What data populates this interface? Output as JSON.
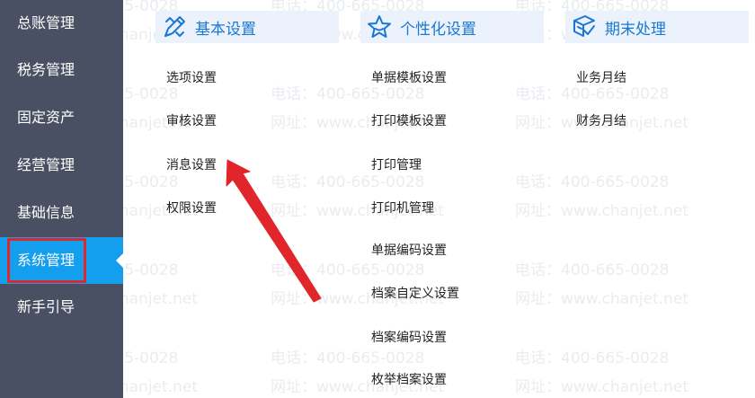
{
  "sidebar": {
    "items": [
      {
        "label": "总账管理"
      },
      {
        "label": "税务管理"
      },
      {
        "label": "固定资产"
      },
      {
        "label": "经营管理"
      },
      {
        "label": "基础信息"
      },
      {
        "label": "系统管理",
        "active": true
      },
      {
        "label": "新手引导"
      }
    ]
  },
  "watermark": {
    "phone": "电话：400-665-0028",
    "site": "网址：www.chanjet.net"
  },
  "columns": [
    {
      "title": "基本设置",
      "icon": "pencil-ruler-icon",
      "items": [
        "选项设置",
        "审核设置",
        "消息设置",
        "权限设置"
      ]
    },
    {
      "title": "个性化设置",
      "icon": "star-icon",
      "items": [
        "单据模板设置",
        "打印模板设置",
        "打印管理",
        "打印机管理",
        "单据编码设置",
        "档案自定义设置",
        "档案编码设置",
        "枚举档案设置"
      ]
    },
    {
      "title": "期末处理",
      "icon": "document-check-icon",
      "items": [
        "业务月结",
        "财务月结"
      ]
    }
  ],
  "colors": {
    "sidebar_bg": "#4a5063",
    "active_bg": "#139eee",
    "highlight_border": "#e0262b",
    "header_bg": "#ecf2fb",
    "header_text": "#1a78d2",
    "arrow": "#e0262b"
  }
}
